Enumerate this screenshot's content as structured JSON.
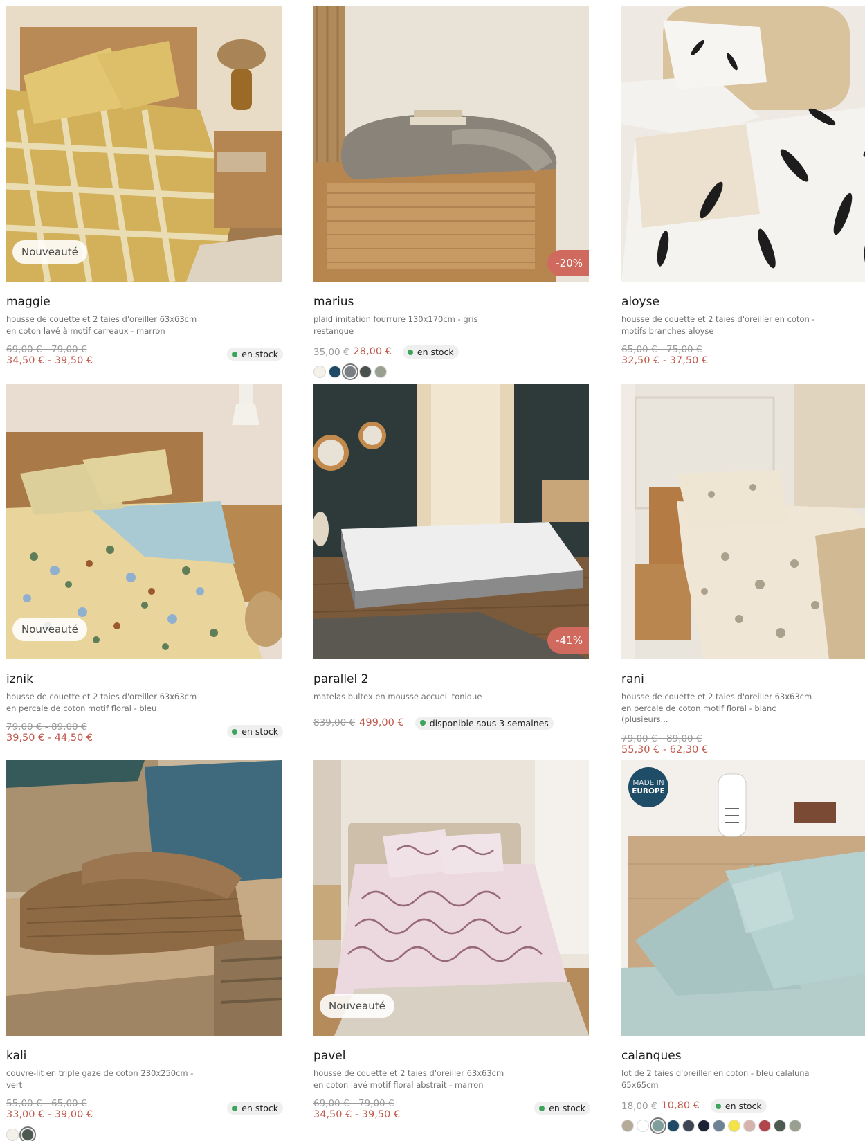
{
  "products": [
    {
      "name": "maggie",
      "desc": "housse de couette et 2 taies d'oreiller 63x63cm en coton lavé à motif carreaux - marron",
      "old_price": "69,00 € - 79,00 €",
      "price": "34,50 € - 39,50 €",
      "stock": "en stock",
      "badge": "Nouveauté",
      "image": "bedroom-yellow-gingham-bed",
      "colors": []
    },
    {
      "name": "marius",
      "desc": "plaid imitation fourrure 130x170cm - gris restanque",
      "old_price": "35,00 €",
      "price": "28,00 €",
      "stock": "en stock",
      "badge": "-20%",
      "image": "grey-faux-fur-throw-on-rattan-dresser",
      "colors": [
        "#f4f1e8",
        "#1e4a67",
        "#7a7f84",
        "#4a514d",
        "#9aa08f"
      ]
    },
    {
      "name": "aloyse",
      "desc": "housse de couette et 2 taies d'oreiller en coton - motifs branches aloyse",
      "old_price": "65,00 € - 75,00 €",
      "price": "32,50 € - 37,50 €",
      "stock": "en stock",
      "badge": "",
      "image": "white-bedding-black-leaf-pattern",
      "colors": []
    },
    {
      "name": "iznik",
      "desc": "housse de couette et 2 taies d'oreiller 63x63cm en percale de coton motif floral - bleu",
      "old_price": "79,00 € - 89,00 €",
      "price": "39,50 € - 44,50 €",
      "stock": "en stock",
      "badge": "Nouveauté",
      "image": "floral-bedding-wooden-headboard",
      "colors": []
    },
    {
      "name": "parallel 2",
      "desc": "matelas bultex en mousse accueil tonique",
      "old_price": "839,00 €",
      "price": "499,00 €",
      "stock": "disponible sous 3 semaines",
      "badge": "-41%",
      "image": "grey-mattress-on-frame-dark-room",
      "colors": []
    },
    {
      "name": "rani",
      "desc": "housse de couette et 2 taies d'oreiller 63x63cm en percale de coton motif floral - blanc (plusieurs...",
      "old_price": "79,00 € - 89,00 €",
      "price": "55,30 € - 62,30 €",
      "stock": "en stock",
      "badge": "",
      "image": "beige-floral-bedding-classic-room",
      "colors": []
    },
    {
      "name": "kali",
      "desc": "couvre-lit en triple gaze de coton 230x250cm - vert",
      "old_price": "55,00 € - 65,00 €",
      "price": "33,00 € - 39,00 €",
      "stock": "en stock",
      "badge": "",
      "image": "folded-brown-throws-on-bench",
      "colors": [
        "#f4f1e8",
        "#4d5a51"
      ]
    },
    {
      "name": "pavel",
      "desc": "housse de couette et 2 taies d'oreiller 63x63cm en coton lavé motif floral abstrait - marron",
      "old_price": "69,00 € - 79,00 €",
      "price": "34,50 € - 39,50 €",
      "stock": "en stock",
      "badge": "Nouveauté",
      "image": "pink-abstract-bedding-bedroom",
      "colors": []
    },
    {
      "name": "calanques",
      "desc": "lot de 2 taies d'oreiller en coton - bleu calaluna 65x65cm",
      "old_price": "18,00 €",
      "price": "10,80 €",
      "stock": "en stock",
      "badge": "",
      "made_in_1": "MADE IN",
      "made_in_2": "EUROPE",
      "image": "mint-pillowcases-on-bed",
      "colors": [
        "#b5ab98",
        "#ffffff",
        "#7f9f9c",
        "#1e4a67",
        "#3e4651",
        "#1b2236",
        "#6f8194",
        "#f4e24a",
        "#d6b2ad",
        "#b1454c",
        "#4d5a51",
        "#9aa08f"
      ]
    }
  ]
}
